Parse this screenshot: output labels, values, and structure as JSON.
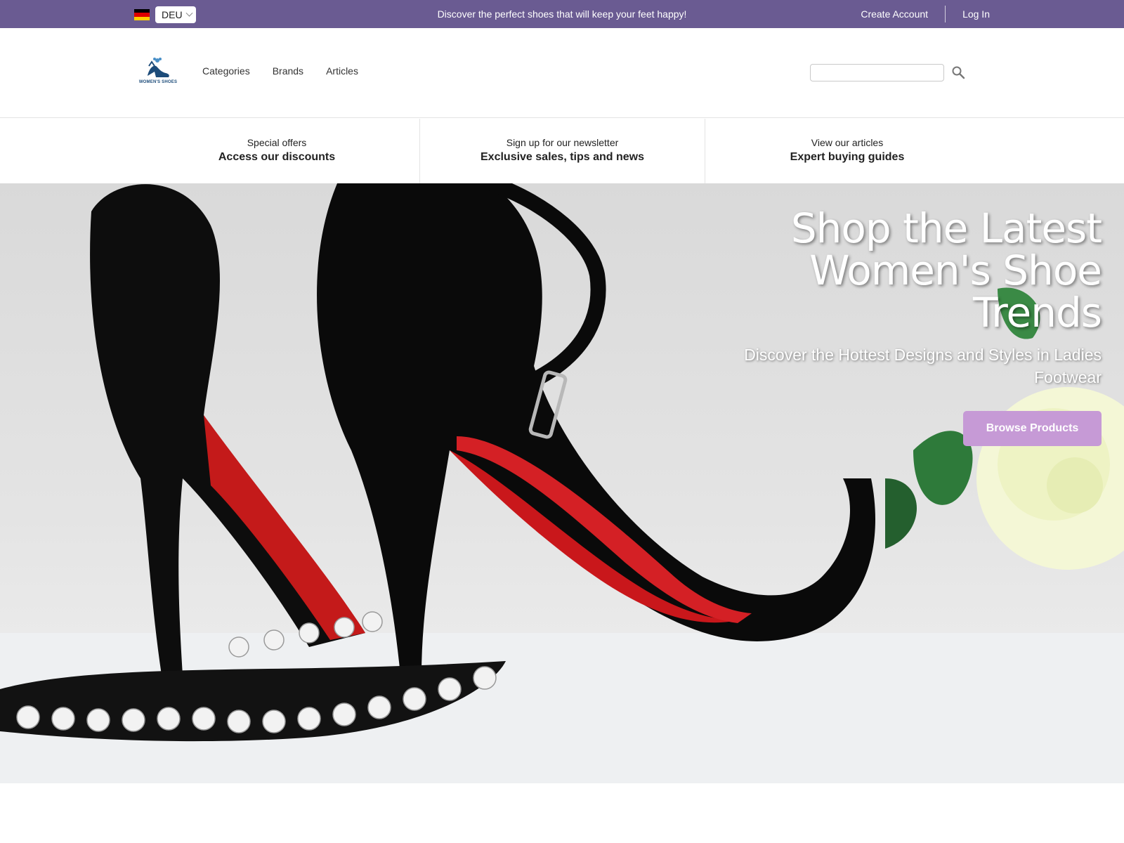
{
  "topbar": {
    "language_code": "DEU",
    "flag_colors": [
      "#000000",
      "#dd0000",
      "#ffce00"
    ],
    "promo_text": "Discover the perfect shoes that will keep your feet happy!",
    "create_account": "Create Account",
    "login": "Log In",
    "background_color": "#6a5b92"
  },
  "header": {
    "logo_text": "WOMEN'S SHOES",
    "nav": [
      "Categories",
      "Brands",
      "Articles"
    ],
    "search_placeholder": "",
    "search_icon": "search-icon"
  },
  "promos": [
    {
      "small": "Special offers",
      "big": "Access our discounts"
    },
    {
      "small": "Sign up for our newsletter",
      "big": "Exclusive sales, tips and news"
    },
    {
      "small": "View our articles",
      "big": "Expert buying guides"
    }
  ],
  "hero": {
    "title": "Shop the Latest Women's Shoe Trends",
    "subtitle": "Discover the Hottest Designs and Styles in Ladies Footwear",
    "button_label": "Browse Products",
    "button_color": "#c69ad6"
  }
}
